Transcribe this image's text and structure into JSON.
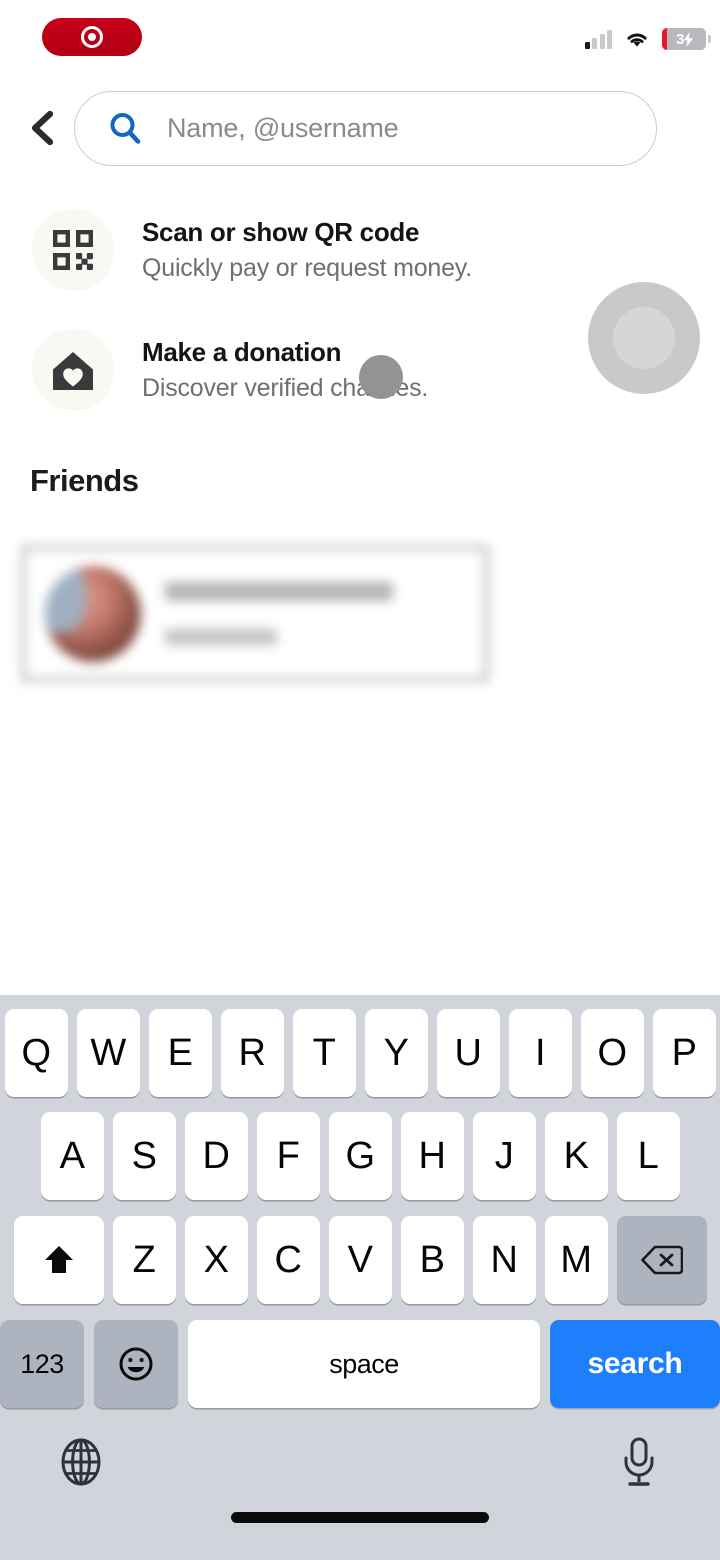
{
  "status_bar": {
    "recording_indicator": "screen-recording-active",
    "signal_label": "cellular-signal",
    "signal_bars_filled": 1,
    "signal_bars_total": 4,
    "wifi_label": "wifi-connected",
    "battery_percent": "3",
    "battery_charging": true,
    "battery_low": true
  },
  "header": {
    "back_label": "Back",
    "search": {
      "placeholder": "Name, @username",
      "value": ""
    }
  },
  "actions": [
    {
      "icon": "qr-code-icon",
      "title": "Scan or show QR code",
      "subtitle": "Quickly pay or request money."
    },
    {
      "icon": "donation-home-heart-icon",
      "title": "Make a donation",
      "subtitle": "Discover verified charities."
    }
  ],
  "friends": {
    "heading": "Friends",
    "items": [
      {
        "name": "",
        "handle": "",
        "redacted": true
      }
    ]
  },
  "keyboard": {
    "row1": [
      "Q",
      "W",
      "E",
      "R",
      "T",
      "Y",
      "U",
      "I",
      "O",
      "P"
    ],
    "row2": [
      "A",
      "S",
      "D",
      "F",
      "G",
      "H",
      "J",
      "K",
      "L"
    ],
    "row3_letters": [
      "Z",
      "X",
      "C",
      "V",
      "B",
      "N",
      "M"
    ],
    "shift_label": "shift",
    "backspace_label": "delete",
    "numbers_label": "123",
    "emoji_label": "emoji",
    "space_label": "space",
    "return_label": "search",
    "globe_label": "next-keyboard",
    "mic_label": "dictation"
  },
  "colors": {
    "accent_blue": "#1f7ffb",
    "search_icon_blue": "#1266c9",
    "recording_red": "#c00012",
    "battery_low_red": "#e8192c",
    "keyboard_bg": "#d1d4db",
    "key_fn_gray": "#adb3bf",
    "icon_circle_cream": "#faf8f3"
  }
}
